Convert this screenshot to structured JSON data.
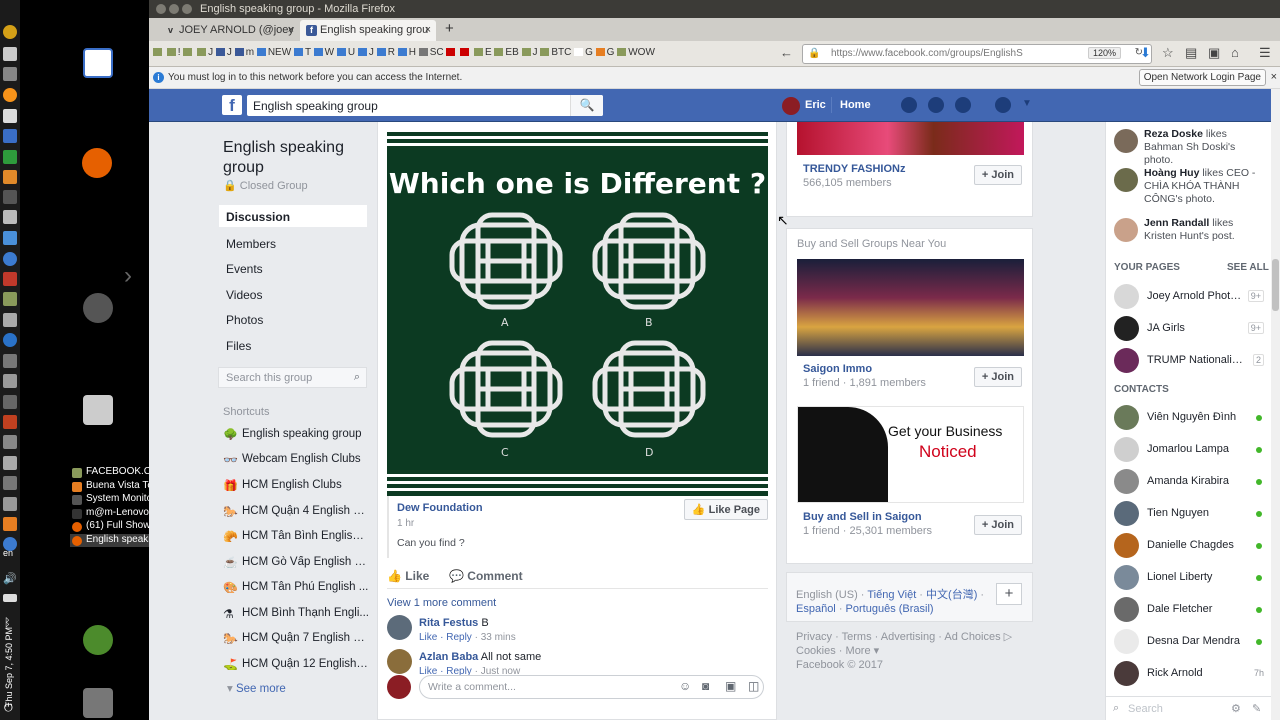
{
  "window": {
    "title": "English speaking group - Mozilla Firefox"
  },
  "tabs": [
    {
      "label": "JOEY ARNOLD (@joey"
    },
    {
      "label": "English speaking grou"
    }
  ],
  "bookmarks": [
    "!",
    "J",
    "J",
    "m",
    "NEW",
    "T",
    "W",
    "U",
    "J",
    "R",
    "H",
    "SC",
    "E",
    "EB",
    "J",
    "BTC",
    "G",
    "G",
    "WOW"
  ],
  "url": {
    "text": "https://www.facebook.com/groups/EnglishS",
    "zoom": "120%"
  },
  "notification": {
    "message": "You must log in to this network before you can access the Internet.",
    "button": "Open Network Login Page"
  },
  "desktop": {
    "clock": "Thu Sep 7, 4:50 PM",
    "lang": "en",
    "tasks": [
      "FACEBOOK.COM",
      "Buena Vista Te...",
      "System Monitor",
      "m@m-Lenovo-...",
      "(61) Full Show -...",
      "English speaki..."
    ]
  },
  "fb_header": {
    "search_value": "English speaking group",
    "user": "Eric",
    "home": "Home"
  },
  "group": {
    "name": "English speaking group",
    "type": "Closed Group",
    "nav": [
      "Discussion",
      "Members",
      "Events",
      "Videos",
      "Photos",
      "Files"
    ],
    "search_placeholder": "Search this group",
    "shortcuts_label": "Shortcuts",
    "shortcuts": [
      "English speaking group",
      "Webcam English Clubs",
      "HCM English Clubs",
      "HCM Quận 4 English Club",
      "HCM Tân Bình English ...",
      "HCM Gò Vấp English Cl...",
      "HCM Tân Phú English ...",
      "HCM Bình Thạnh Engli...",
      "HCM Quận 7 English Club",
      "HCM Quận 12 English ..."
    ],
    "see_more": "See more"
  },
  "post": {
    "image_title": "Which one is Different ?",
    "options": [
      "A",
      "B",
      "C",
      "D"
    ],
    "source": "Dew Foundation",
    "time": "1 hr",
    "description": "Can you find ?",
    "like_page": "Like Page",
    "like": "Like",
    "comment": "Comment",
    "view_more": "View 1 more comment",
    "comments": [
      {
        "name": "Rita Festus",
        "text": "B",
        "actions": "Like · Reply",
        "time": " · 33 mins"
      },
      {
        "name": "Azlan Baba",
        "text": "All not same",
        "actions": "Like · Reply",
        "time": " · Just now"
      }
    ],
    "write_placeholder": "Write a comment..."
  },
  "suggested": [
    {
      "name": "TRENDY FASHIONz",
      "meta": "566,105 members",
      "join": "Join"
    }
  ],
  "near_header": "Buy and Sell Groups Near You",
  "near_groups": [
    {
      "name": "Saigon Immo",
      "meta": "1 friend · 1,891 members",
      "join": "Join"
    },
    {
      "name": "Buy and Sell in Saigon",
      "meta": "1 friend · 25,301 members",
      "join": "Join",
      "ad_line1": "Get your Business",
      "ad_line2": "Noticed"
    }
  ],
  "languages": {
    "current": "English (US)",
    "others": [
      "Tiếng Việt",
      "中文(台灣)",
      "Español",
      "Português (Brasil)"
    ]
  },
  "footer": [
    "Privacy",
    "Terms",
    "Advertising",
    "Ad Choices",
    "Cookies",
    "More",
    "Facebook © 2017"
  ],
  "ticker": [
    {
      "name": "Reza Doske",
      "text": " likes Bahman Sh Doski's photo."
    },
    {
      "name": "Hoàng Huy",
      "text": " likes CEO - CHÌA KHÓA THÀNH CÔNG's photo."
    },
    {
      "name": "Jenn Randall",
      "text": " likes Kristen Hunt's post."
    }
  ],
  "your_pages": {
    "label": "YOUR PAGES",
    "see_all": "SEE ALL",
    "pages": [
      {
        "name": "Joey Arnold Photos S...",
        "count": "9+"
      },
      {
        "name": "JA Girls",
        "count": "9+"
      },
      {
        "name": "TRUMP Nationalism O...",
        "count": "2"
      }
    ]
  },
  "contacts": {
    "label": "CONTACTS",
    "list": [
      {
        "name": "Viên Nguyễn Đình",
        "status": ""
      },
      {
        "name": "Jomarlou Lampa",
        "status": ""
      },
      {
        "name": "Amanda Kirabira",
        "status": ""
      },
      {
        "name": "Tien Nguyen",
        "status": ""
      },
      {
        "name": "Danielle Chagdes",
        "status": ""
      },
      {
        "name": "Lionel Liberty",
        "status": ""
      },
      {
        "name": "Dale Fletcher",
        "status": ""
      },
      {
        "name": "Desna Dar Mendra",
        "status": ""
      },
      {
        "name": "Rick Arnold",
        "status": "7h"
      }
    ]
  },
  "chat_search": "Search",
  "colors": {
    "fb_blue": "#4267b2",
    "link": "#365899",
    "online": "#42b72a",
    "puzzle_bg": "#0c3a22"
  }
}
